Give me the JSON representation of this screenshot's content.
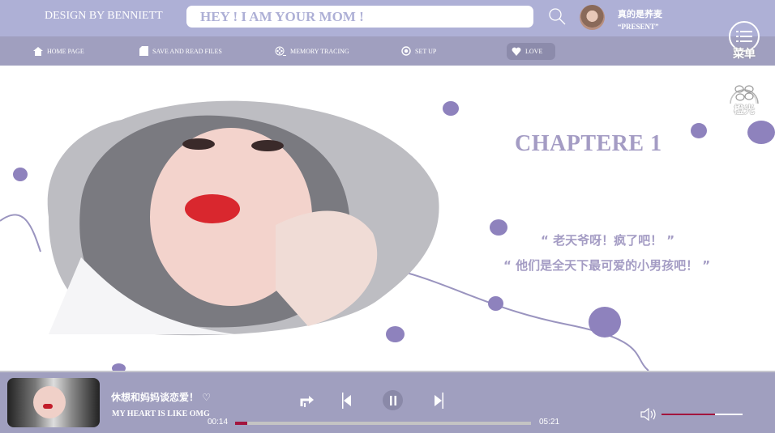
{
  "header": {
    "brand": "DESIGN BY BENNIETT",
    "search_value": "HEY ! I AM YOUR MOM !",
    "user_name": "真的是荞麦",
    "user_subtitle": "“PRESENT”"
  },
  "nav": {
    "items": [
      {
        "label": "HOME PAGE",
        "icon": "home-icon"
      },
      {
        "label": "SAVE AND READ FILES",
        "icon": "file-icon"
      },
      {
        "label": "MEMORY TRACING",
        "icon": "film-reel-icon"
      },
      {
        "label": "SET UP",
        "icon": "settings-icon"
      },
      {
        "label": "LOVE",
        "icon": "heart-icon",
        "active": true
      }
    ]
  },
  "side": {
    "menu_label": "菜单",
    "orange_label": "橙光"
  },
  "main": {
    "chapter": "CHAPTERE 1",
    "quote1": "“ 老天爷呀！疯了吧！ ”",
    "quote2": "“ 他们是全天下最可爱的小男孩吧！ ”"
  },
  "player": {
    "song": "休想和妈妈谈恋爱！",
    "artist": "MY HEART IS LIKE OMG",
    "current": "00:14",
    "total": "05:21",
    "progress_percent": 4,
    "volume_percent": 66
  },
  "colors": {
    "accent": "#8e82bd",
    "header": "#aeb0d6",
    "nav": "#a09fbf",
    "progress": "#a3153e"
  }
}
